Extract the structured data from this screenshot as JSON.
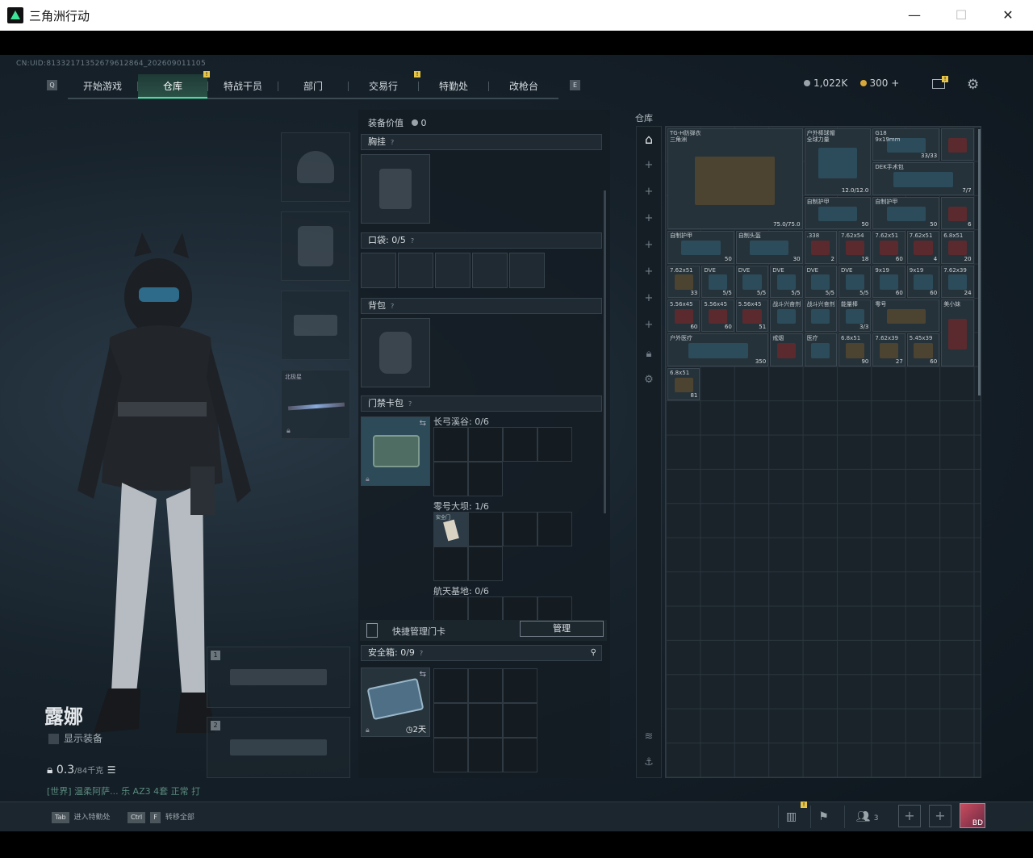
{
  "window": {
    "title": "三角洲行动",
    "minimize": "—",
    "maximize": "☐",
    "close": "✕"
  },
  "uid": "CN:UID:8133217135267961286‌4_202609011105",
  "nav": {
    "tabs": [
      "开始游戏",
      "仓库",
      "特战干员",
      "部门",
      "交易行",
      "特勤处",
      "改枪台"
    ],
    "active_index": 1,
    "left_key": "Q",
    "right_key": "E",
    "badge": "!"
  },
  "currency": {
    "coins": "1,022K",
    "tickets": "300",
    "plus": "+"
  },
  "colors": {
    "accent": "#3ee39a",
    "badge": "#e7c548"
  },
  "character": {
    "name": "露娜",
    "show_equipment": "显示装备",
    "weight": "0.3",
    "weight_max": "/84千克",
    "chat": "[世界] 温柔阿萨... 乐   AZ3  4套  正常  打"
  },
  "loadout": {
    "value_label": "装备价值",
    "value": "0",
    "chest": "胸挂",
    "pockets": "口袋: 0/5",
    "backpack": "背包",
    "keycard": "门禁卡包",
    "slot_label_melee": "北极星",
    "keycard_maps": [
      {
        "label": "长弓溪谷: 0/6"
      },
      {
        "label": "零号大坝: 1/6"
      },
      {
        "label": "航天基地: 0/6"
      }
    ],
    "keycard_item": "安全门",
    "quick_manage": "快捷管理门卡",
    "manage_btn": "管理",
    "safe_box": "安全箱: 0/9",
    "safe_days": "2天",
    "weapon_slot_1": "1",
    "weapon_slot_2": "2"
  },
  "stash": {
    "label": "仓库",
    "items": [
      {
        "name": "TG-H防弹衣\n三角洲",
        "count": "75.0/75.0",
        "color": "gold"
      },
      {
        "name": "户外棒球帽\n全球力量",
        "count": "12.0/12.0",
        "color": "blue"
      },
      {
        "name": "G18\n9x19mm",
        "count": "33/33",
        "color": "blue"
      },
      {
        "name": "",
        "count": "",
        "color": "red"
      },
      {
        "name": "DEK手术包",
        "count": "7/7",
        "color": "blue"
      },
      {
        "name": "自制护甲",
        "count": "50",
        "color": "blue"
      },
      {
        "name": "自制护甲",
        "count": "50",
        "color": "blue"
      },
      {
        "name": "",
        "count": "6",
        "color": "red"
      },
      {
        "name": "自制护甲",
        "count": "50",
        "color": "blue"
      },
      {
        "name": "自制头盔",
        "count": "30",
        "color": "blue"
      },
      {
        "name": ".338",
        "count": "2",
        "color": "red"
      },
      {
        "name": "7.62x54",
        "count": "18",
        "color": "red"
      },
      {
        "name": "7.62x51",
        "count": "60",
        "color": "red"
      },
      {
        "name": "7.62x51",
        "count": "4",
        "color": "red"
      },
      {
        "name": "6.8x51",
        "count": "20",
        "color": "red"
      },
      {
        "name": "7.62x51",
        "count": "33",
        "color": "gold"
      },
      {
        "name": "DVE",
        "count": "5/5",
        "color": "blue"
      },
      {
        "name": "DVE",
        "count": "5/5",
        "color": "blue"
      },
      {
        "name": "DVE",
        "count": "5/5",
        "color": "blue"
      },
      {
        "name": "DVE",
        "count": "5/5",
        "color": "blue"
      },
      {
        "name": "DVE",
        "count": "5/5",
        "color": "blue"
      },
      {
        "name": "9x19",
        "count": "60",
        "color": "blue"
      },
      {
        "name": "9x19",
        "count": "60",
        "color": "blue"
      },
      {
        "name": "7.62x39",
        "count": "24",
        "color": "blue"
      },
      {
        "name": "5.56x45",
        "count": "60",
        "color": "red"
      },
      {
        "name": "5.56x45",
        "count": "60",
        "color": "red"
      },
      {
        "name": "5.56x45",
        "count": "51",
        "color": "red"
      },
      {
        "name": "战斗兴奋剂",
        "count": "",
        "color": "blue"
      },
      {
        "name": "战斗兴奋剂",
        "count": "",
        "color": "blue"
      },
      {
        "name": "能量棒",
        "count": "3/3",
        "color": "blue"
      },
      {
        "name": "零号",
        "count": "",
        "color": "gold"
      },
      {
        "name": "美小妹",
        "count": "",
        "color": "red"
      },
      {
        "name": "户外医疗",
        "count": "350",
        "color": "blue"
      },
      {
        "name": "戒烟",
        "count": "",
        "color": "red"
      },
      {
        "name": "医疗",
        "count": "",
        "color": "blue"
      },
      {
        "name": "6.8x51",
        "count": "90",
        "color": "gold"
      },
      {
        "name": "7.62x39",
        "count": "27",
        "color": "gold"
      },
      {
        "name": "5.45x39",
        "count": "60",
        "color": "gold"
      },
      {
        "name": "6.8x51",
        "count": "81",
        "color": "gold"
      }
    ]
  },
  "bottom": {
    "hint1_key": "Tab",
    "hint1": "进入特勤处",
    "hint2_key": "Ctrl",
    "hint2_key2": "F",
    "hint2": "转移全部",
    "party_count": "3",
    "avatar_label": "BD"
  }
}
